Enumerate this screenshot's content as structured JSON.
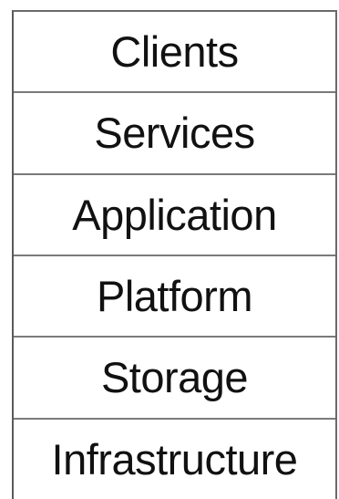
{
  "layers": [
    {
      "label": "Clients"
    },
    {
      "label": "Services"
    },
    {
      "label": "Application"
    },
    {
      "label": "Platform"
    },
    {
      "label": "Storage"
    },
    {
      "label": "Infrastructure"
    }
  ]
}
